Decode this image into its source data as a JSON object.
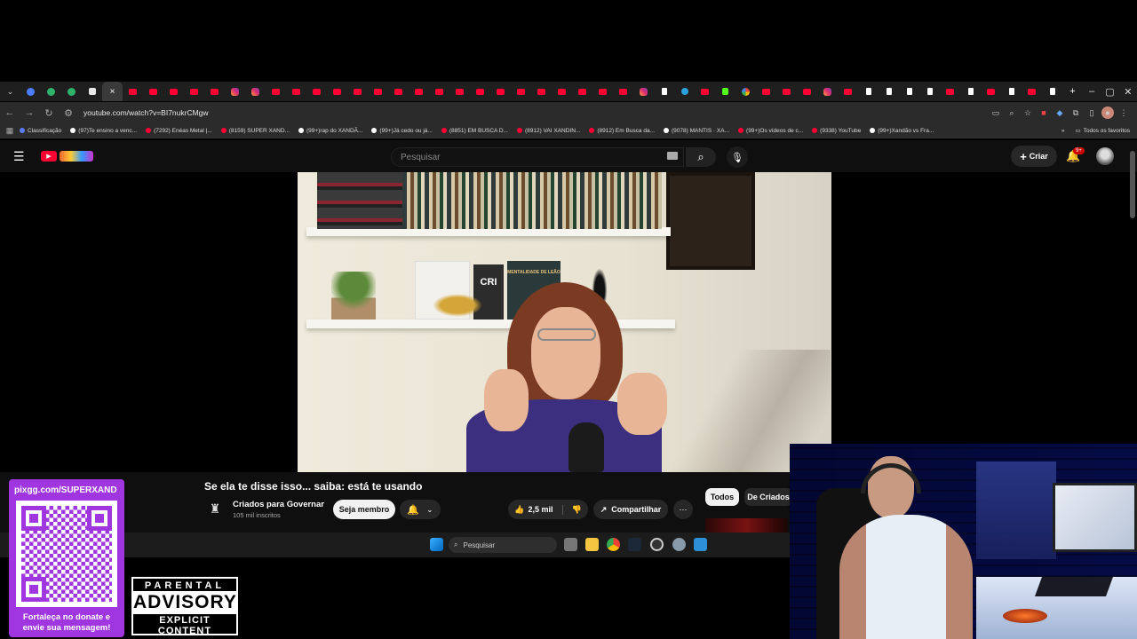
{
  "browser": {
    "url": "youtube.com/watch?v=BI7nukrCMgw",
    "favorites_label": "Todos os favoritos",
    "bookmarks": [
      "Classificação",
      "(97)Te ensino a venc...",
      "(7292) Enéas Metal |...",
      "(8159) SUPER XAND...",
      "(99+)rap do XANDÃ...",
      "(99+)Já cedo ou já...",
      "(8851) EM BUSCA D...",
      "(8912) VAI XANDIN...",
      "(8912) Em Busca da...",
      "(9078) MANTIS · XA...",
      "(99+)Os vídeos de c...",
      "(9338) YouTube",
      "(99+)Xandão vs Fra..."
    ],
    "tab_icons": [
      "chevron",
      "blue",
      "green",
      "green",
      "white",
      "close",
      "yt",
      "yt",
      "yt",
      "yt",
      "yt",
      "ig",
      "ig",
      "yt",
      "yt",
      "yt",
      "yt",
      "yt",
      "yt",
      "yt",
      "yt",
      "yt",
      "yt",
      "yt",
      "yt",
      "yt",
      "yt",
      "yt",
      "yt",
      "yt",
      "yt",
      "ig",
      "tt",
      "tg",
      "yt",
      "kick",
      "google",
      "yt",
      "yt",
      "yt",
      "ig",
      "yt",
      "tt",
      "tt",
      "tt",
      "tt",
      "yt",
      "tt",
      "yt",
      "tt",
      "yt",
      "tt"
    ]
  },
  "youtube": {
    "search_placeholder": "Pesquisar",
    "create_label": "Criar",
    "notification_count": "9+",
    "video_title": "Se ela te disse isso... saiba: está te usando",
    "channel_name": "Criados para Governar",
    "subscribers": "105 mil inscritos",
    "member_button": "Seja membro",
    "likes": "2,5 mil",
    "share_label": "Compartilhar",
    "chips": [
      "Todos",
      "De Criados"
    ],
    "book_labels": [
      "CRI",
      "MENTALIDADE DE LEÃO"
    ]
  },
  "taskbar": {
    "search_label": "Pesquisar"
  },
  "overlay": {
    "pix_url": "pixgg.com/SUPERXAND",
    "donate_text": "Fortaleça no donate e envie sua mensagem!",
    "advisory_top": "PARENTAL",
    "advisory_main": "ADVISORY",
    "advisory_bottom": "EXPLICIT CONTENT"
  },
  "colors": {
    "youtube_red": "#ff0033",
    "panel_purple": "#a036e0",
    "dark_bg": "#0f0f0f"
  }
}
